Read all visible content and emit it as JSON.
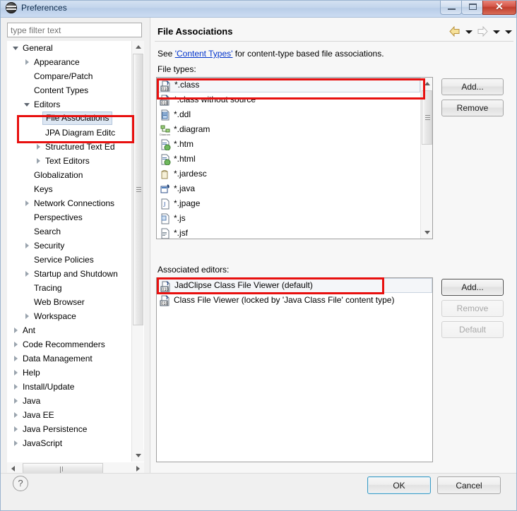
{
  "window": {
    "title": "Preferences",
    "icon": "eclipse-preferences-icon",
    "controls": {
      "minimize": "minimize-button",
      "maximize": "maximize-button",
      "close_glyph": "✕"
    }
  },
  "filter": {
    "placeholder": "type filter text",
    "value": ""
  },
  "tree": {
    "items": [
      {
        "label": "General",
        "indent": 0,
        "twisty": "expanded",
        "selected": false
      },
      {
        "label": "Appearance",
        "indent": 1,
        "twisty": "collapsed",
        "selected": false
      },
      {
        "label": "Compare/Patch",
        "indent": 1,
        "twisty": "none",
        "selected": false
      },
      {
        "label": "Content Types",
        "indent": 1,
        "twisty": "none",
        "selected": false
      },
      {
        "label": "Editors",
        "indent": 1,
        "twisty": "expanded",
        "selected": false
      },
      {
        "label": "File Associations",
        "indent": 2,
        "twisty": "none",
        "selected": true
      },
      {
        "label": "JPA Diagram Editc",
        "indent": 2,
        "twisty": "none",
        "selected": false
      },
      {
        "label": "Structured Text Ed",
        "indent": 2,
        "twisty": "collapsed",
        "selected": false
      },
      {
        "label": "Text Editors",
        "indent": 2,
        "twisty": "collapsed",
        "selected": false
      },
      {
        "label": "Globalization",
        "indent": 1,
        "twisty": "none",
        "selected": false
      },
      {
        "label": "Keys",
        "indent": 1,
        "twisty": "none",
        "selected": false
      },
      {
        "label": "Network Connections",
        "indent": 1,
        "twisty": "collapsed",
        "selected": false
      },
      {
        "label": "Perspectives",
        "indent": 1,
        "twisty": "none",
        "selected": false
      },
      {
        "label": "Search",
        "indent": 1,
        "twisty": "none",
        "selected": false
      },
      {
        "label": "Security",
        "indent": 1,
        "twisty": "collapsed",
        "selected": false
      },
      {
        "label": "Service Policies",
        "indent": 1,
        "twisty": "none",
        "selected": false
      },
      {
        "label": "Startup and Shutdown",
        "indent": 1,
        "twisty": "collapsed",
        "selected": false
      },
      {
        "label": "Tracing",
        "indent": 1,
        "twisty": "none",
        "selected": false
      },
      {
        "label": "Web Browser",
        "indent": 1,
        "twisty": "none",
        "selected": false
      },
      {
        "label": "Workspace",
        "indent": 1,
        "twisty": "collapsed",
        "selected": false
      },
      {
        "label": "Ant",
        "indent": 0,
        "twisty": "collapsed",
        "selected": false
      },
      {
        "label": "Code Recommenders",
        "indent": 0,
        "twisty": "collapsed",
        "selected": false
      },
      {
        "label": "Data Management",
        "indent": 0,
        "twisty": "collapsed",
        "selected": false
      },
      {
        "label": "Help",
        "indent": 0,
        "twisty": "collapsed",
        "selected": false
      },
      {
        "label": "Install/Update",
        "indent": 0,
        "twisty": "collapsed",
        "selected": false
      },
      {
        "label": "Java",
        "indent": 0,
        "twisty": "collapsed",
        "selected": false
      },
      {
        "label": "Java EE",
        "indent": 0,
        "twisty": "collapsed",
        "selected": false
      },
      {
        "label": "Java Persistence",
        "indent": 0,
        "twisty": "collapsed",
        "selected": false
      },
      {
        "label": "JavaScript",
        "indent": 0,
        "twisty": "collapsed",
        "selected": false
      }
    ]
  },
  "page": {
    "title": "File Associations",
    "description_prefix": "See ",
    "description_link": "'Content Types'",
    "description_suffix": " for content-type based file associations.",
    "nav": {
      "back": "back-arrow-icon",
      "back_menu": "back-dropdown-icon",
      "forward": "forward-arrow-icon",
      "forward_menu": "forward-dropdown-icon",
      "view_menu": "view-menu-icon"
    }
  },
  "file_types": {
    "label": "File types:",
    "items": [
      {
        "name": "*.class",
        "icon": "class-file-icon",
        "selected": true
      },
      {
        "name": "*.class without source",
        "icon": "class-file-icon",
        "selected": false
      },
      {
        "name": "*.ddl",
        "icon": "ddl-file-icon",
        "selected": false
      },
      {
        "name": "*.diagram",
        "icon": "diagram-file-icon",
        "selected": false
      },
      {
        "name": "*.htm",
        "icon": "html-file-icon",
        "selected": false
      },
      {
        "name": "*.html",
        "icon": "html-file-icon",
        "selected": false
      },
      {
        "name": "*.jardesc",
        "icon": "jardesc-file-icon",
        "selected": false
      },
      {
        "name": "*.java",
        "icon": "java-file-icon",
        "selected": false
      },
      {
        "name": "*.jpage",
        "icon": "jpage-file-icon",
        "selected": false
      },
      {
        "name": "*.js",
        "icon": "js-file-icon",
        "selected": false
      },
      {
        "name": "*.jsf",
        "icon": "jsf-file-icon",
        "selected": false
      }
    ],
    "add_label": "Add...",
    "remove_label": "Remove"
  },
  "associated_editors": {
    "label": "Associated editors:",
    "items": [
      {
        "name": "JadClipse Class File Viewer (default)",
        "icon": "class-file-icon",
        "selected": true
      },
      {
        "name": "Class File Viewer (locked by 'Java Class File' content type)",
        "icon": "class-file-icon",
        "selected": false
      }
    ],
    "add_label": "Add...",
    "remove_label": "Remove",
    "default_label": "Default",
    "add_enabled": true,
    "remove_enabled": false,
    "default_enabled": false
  },
  "footer": {
    "help_label": "?",
    "ok_label": "OK",
    "cancel_label": "Cancel"
  },
  "colors": {
    "annotation_red": "#e8100f",
    "link_blue": "#0033cc",
    "default_button_border": "#3c9bc4",
    "titlebar_blue": "#c3d5ec",
    "close_button_red": "#c03e2d"
  }
}
